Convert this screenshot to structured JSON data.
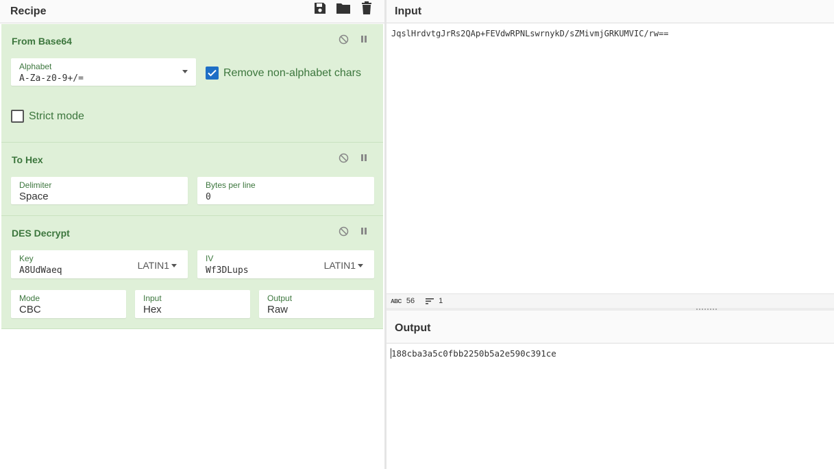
{
  "recipe": {
    "title": "Recipe",
    "icons": [
      "save-icon",
      "folder-icon",
      "trash-icon"
    ],
    "operations": [
      {
        "title": "From Base64",
        "alphabet_label": "Alphabet",
        "alphabet_value": "A-Za-z0-9+/=",
        "remove_nonalpha_label": "Remove non-alphabet chars",
        "remove_nonalpha_checked": true,
        "strict_mode_label": "Strict mode",
        "strict_mode_checked": false
      },
      {
        "title": "To Hex",
        "delimiter_label": "Delimiter",
        "delimiter_value": "Space",
        "bytes_per_line_label": "Bytes per line",
        "bytes_per_line_value": "0"
      },
      {
        "title": "DES Decrypt",
        "key_label": "Key",
        "key_value": "A8UdWaeq",
        "key_encoding": "LATIN1",
        "iv_label": "IV",
        "iv_value": "Wf3DLups",
        "iv_encoding": "LATIN1",
        "mode_label": "Mode",
        "mode_value": "CBC",
        "input_label": "Input",
        "input_value": "Hex",
        "output_label": "Output",
        "output_value": "Raw"
      }
    ]
  },
  "input": {
    "title": "Input",
    "text": "JqslHrdvtgJrRs2QAp+FEVdwRPNLswrnykD/sZMivmjGRKUMVIC/rw==",
    "status_chars_icon": "ABC",
    "status_chars": "56",
    "status_lines": "1"
  },
  "output": {
    "title": "Output",
    "text": "188cba3a5c0fbb2250b5a2e590c391ce"
  },
  "colors": {
    "operation_bg": "#dff0d8",
    "operation_text": "#3c763d",
    "checkbox_checked": "#1e6fc6"
  }
}
